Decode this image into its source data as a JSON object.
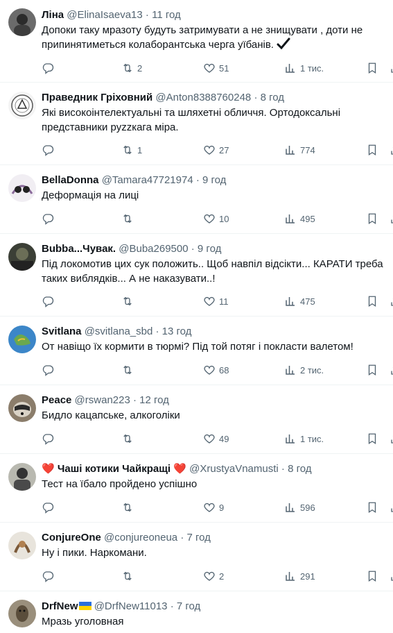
{
  "tweets": [
    {
      "name": "Ліна",
      "handle": "@ElinaIsaeva13",
      "time": "11 год",
      "text": "Допоки таку мразоту будуть затримувати а не знищувати , доти не припинятиметься колаборантська черга уїбанів.",
      "extra_icon": "check-mark-icon",
      "replies": "",
      "retweets": "2",
      "likes": "51",
      "views": "1 тис."
    },
    {
      "name": "Праведник Гріховний",
      "handle": "@Anton8388760248",
      "time": "8 год",
      "text": "Які високоінтелектуальні та шляхетні обличчя. Ортодоксальні представники руzzкага міра.",
      "replies": "",
      "retweets": "1",
      "likes": "27",
      "views": "774"
    },
    {
      "name": "BellaDonna",
      "handle": "@Tamara47721974",
      "time": "9 год",
      "text": "Деформація на лиці",
      "replies": "",
      "retweets": "",
      "likes": "10",
      "views": "495"
    },
    {
      "name": "Bubba...Чувак.",
      "handle": "@Buba269500",
      "time": "9 год",
      "text": "Під локомотив цих сук положить.. Щоб навпіл відсікти... КАРАТИ треба таких виблядків... А не наказувати..!",
      "replies": "",
      "retweets": "",
      "likes": "11",
      "views": "475"
    },
    {
      "name": "Svitlana",
      "handle": "@svitlana_sbd",
      "time": "13 год",
      "text": "От навіщо  їх кормити в тюрмі? Під той потяг і покласти валетом!",
      "replies": "",
      "retweets": "",
      "likes": "68",
      "views": "2 тис."
    },
    {
      "name": "Peace",
      "handle": "@rswan223",
      "time": "12 год",
      "text": "Бидло кацапське, алкоголіки",
      "replies": "",
      "retweets": "",
      "likes": "49",
      "views": "1 тис."
    },
    {
      "name": "Чаші котики Чайкращі",
      "handle": "@XrustyaVnamusti",
      "time": "8 год",
      "text": "Тест на їбало пройдено успішно",
      "replies": "",
      "retweets": "",
      "likes": "9",
      "views": "596"
    },
    {
      "name": "ConjureOne",
      "handle": "@conjureoneua",
      "time": "7 год",
      "text": "Ну і пики. Наркомани.",
      "replies": "",
      "retweets": "",
      "likes": "2",
      "views": "291"
    },
    {
      "name": "DrfNew",
      "handle": "@DrfNew11013",
      "time": "7 год",
      "text": "Мразь уголовная",
      "name_flag": "ukraine-flag"
    }
  ],
  "separator": "·",
  "colors": {
    "text": "#0f1419",
    "muted": "#536471",
    "divider": "#eff3f4"
  },
  "icons": {
    "reply": "reply-icon",
    "retweet": "retweet-icon",
    "like": "heart-icon",
    "views": "views-icon",
    "bookmark": "bookmark-icon",
    "share": "share-icon"
  }
}
